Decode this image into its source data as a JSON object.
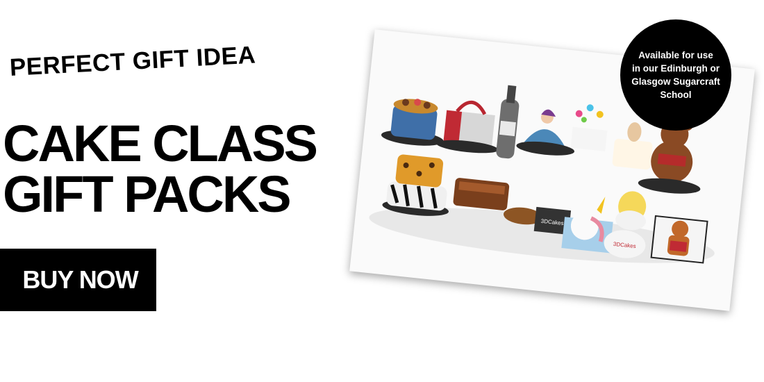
{
  "banner": {
    "tagline": "PERFECT GIFT IDEA",
    "headline": "CAKE CLASS\nGIFT PACKS",
    "cta_label": "BUY NOW"
  },
  "badge": {
    "text": "Available for use\nin our Edinburgh or\nGlasgow Sugarcraft\nSchool"
  },
  "photo": {
    "card_logo_text": "3DCakes",
    "plate_logo_text": "3DCakes"
  },
  "colors": {
    "background": "#ffffff",
    "text": "#000000",
    "button_bg": "#000000",
    "button_text": "#ffffff",
    "badge_bg": "#000000"
  }
}
